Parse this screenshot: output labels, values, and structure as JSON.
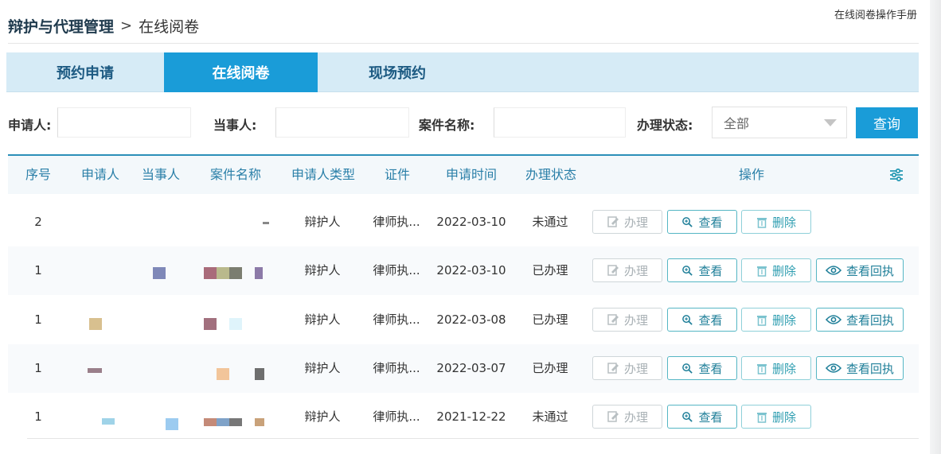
{
  "header": {
    "manual_link": "在线阅卷操作手册",
    "breadcrumb_main": "辩护与代理管理",
    "breadcrumb_sep": ">",
    "breadcrumb_sub": "在线阅卷"
  },
  "tabs": [
    {
      "label": "预约申请",
      "active": false
    },
    {
      "label": "在线阅卷",
      "active": true
    },
    {
      "label": "现场预约",
      "active": false
    }
  ],
  "filters": {
    "applicant_label": "申请人:",
    "party_label": "当事人:",
    "case_label": "案件名称:",
    "status_label": "办理状态:",
    "status_value": "全部",
    "query_button": "查询"
  },
  "table": {
    "columns": [
      "序号",
      "申请人",
      "当事人",
      "案件名称",
      "申请人类型",
      "证件",
      "申请时间",
      "办理状态",
      "操作"
    ],
    "rows": [
      {
        "no": "2",
        "applicant_type": "辩护人",
        "cert": "律师执...",
        "date": "2022-03-10",
        "status": "未通过",
        "has_receipt": false
      },
      {
        "no": "1",
        "applicant_type": "辩护人",
        "cert": "律师执...",
        "date": "2022-03-10",
        "status": "已办理",
        "has_receipt": true
      },
      {
        "no": "1",
        "applicant_type": "辩护人",
        "cert": "律师执...",
        "date": "2022-03-08",
        "status": "已办理",
        "has_receipt": true
      },
      {
        "no": "1",
        "applicant_type": "辩护人",
        "cert": "律师执...",
        "date": "2022-03-07",
        "status": "已办理",
        "has_receipt": true
      },
      {
        "no": "1",
        "applicant_type": "辩护人",
        "cert": "律师执...",
        "date": "2021-12-22",
        "status": "未通过",
        "has_receipt": false
      }
    ],
    "actions": {
      "handle": "办理",
      "view": "查看",
      "delete": "删除",
      "view_receipt": "查看回执"
    }
  },
  "colors": {
    "accent": "#1a9cd8",
    "tab_bar": "#d6ebf6",
    "header_text": "#2a7fa8",
    "button_border": "#55b6c4"
  }
}
